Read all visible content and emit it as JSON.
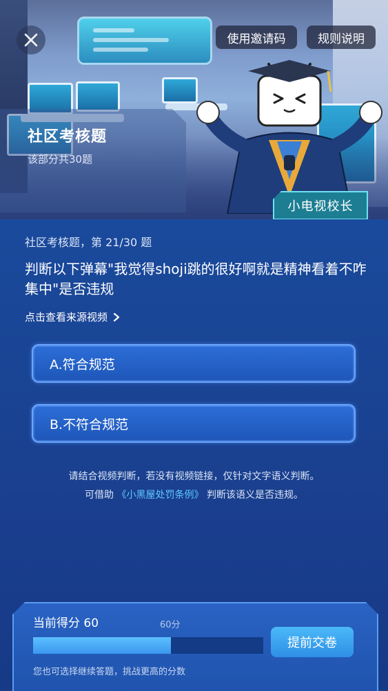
{
  "header": {
    "invite_label": "使用邀请码",
    "rules_label": "规则说明",
    "section_title": "社区考核题",
    "section_subtitle": "该部分共30题",
    "host_tag": "小电视校长"
  },
  "quiz": {
    "progress": "社区考核题，第 21/30 题",
    "question": "判断以下弹幕\"我觉得shoji跳的很好啊就是精神看着不咋集中\"是否违规",
    "source_link": "点击查看来源视频",
    "options": [
      {
        "label": "A.符合规范"
      },
      {
        "label": "B.不符合规范"
      }
    ],
    "hint_line1": "请结合视频判断，若没有视频链接，仅针对文字语义判断。",
    "hint_line2_pre": "可借助",
    "hint_link": "《小黑屋处罚条例》",
    "hint_line2_post": "判断该语义是否违规。"
  },
  "score": {
    "title": "当前得分 60",
    "target_label": "60分",
    "progress_fraction": 0.6,
    "submit_label": "提前交卷",
    "tip": "您也可选择继续答题，挑战更高的分数"
  },
  "icons": {
    "close": "close-icon",
    "chevron": "chevron-right-icon"
  },
  "colors": {
    "accent": "#3c97ee",
    "link": "#5fc7ff"
  }
}
